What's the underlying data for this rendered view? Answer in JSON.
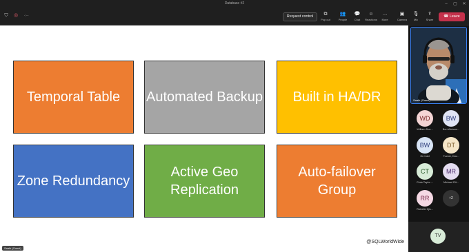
{
  "window": {
    "title": "Database #2"
  },
  "toolbar": {
    "timer": "-:--",
    "request_control": "Request control",
    "tools": [
      {
        "icon": "pop-out-icon",
        "glyph": "⧉",
        "label": "Pop out"
      },
      {
        "icon": "people-icon",
        "glyph": "👥",
        "label": "People"
      },
      {
        "icon": "chat-icon",
        "glyph": "💬",
        "label": "Chat"
      },
      {
        "icon": "reactions-icon",
        "glyph": "☺",
        "label": "Reactions"
      },
      {
        "icon": "more-icon",
        "glyph": "…",
        "label": "More"
      },
      {
        "icon": "camera-icon",
        "glyph": "▣",
        "label": "Camera"
      },
      {
        "icon": "mic-icon",
        "glyph": "🎙",
        "label": "Mic"
      },
      {
        "icon": "share-icon",
        "glyph": "⇪",
        "label": "Share"
      }
    ],
    "leave": "Leave"
  },
  "slide": {
    "tiles": [
      {
        "text": "Temporal Table",
        "color": "#ED7D31"
      },
      {
        "text": "Automated Backup",
        "color": "#A5A5A5"
      },
      {
        "text": "Built in HA/DR",
        "color": "#FFC000"
      },
      {
        "text": "Zone Redundancy",
        "color": "#4472C4"
      },
      {
        "text": "Active Geo Replication",
        "color": "#70AD47"
      },
      {
        "text": "Auto-failover Group",
        "color": "#ED7D31"
      }
    ],
    "watermark": "@SQLWorldWide"
  },
  "presenter_tag": "Saaib (Guest)",
  "video": {
    "name": "Saaib (Guest)"
  },
  "participants": [
    {
      "initials": "WD",
      "name": "William Dun...",
      "bg": "#f5d5d5",
      "fg": "#7a2a2a"
    },
    {
      "initials": "BW",
      "name": "Ben Weissm...",
      "bg": "#e0e4f5",
      "fg": "#2a3a7a"
    },
    {
      "initials": "BW",
      "name": "On hold",
      "bg": "#d8e4f5",
      "fg": "#2a3a7a"
    },
    {
      "initials": "DT",
      "name": "Tucker, Dav...",
      "bg": "#f5e6c8",
      "fg": "#7a5a2a"
    },
    {
      "initials": "CT",
      "name": "Chris Taylor ...",
      "bg": "#d8ecd8",
      "fg": "#2a5a2a"
    },
    {
      "initials": "MR",
      "name": "Michael Rit...",
      "bg": "#e4dcf0",
      "fg": "#4a2a6a"
    },
    {
      "initials": "RR",
      "name": "Richelle Kjis...",
      "bg": "#f5d8e4",
      "fg": "#7a2a4a"
    }
  ],
  "more_count": "+2",
  "tv": {
    "initials": "TV"
  }
}
